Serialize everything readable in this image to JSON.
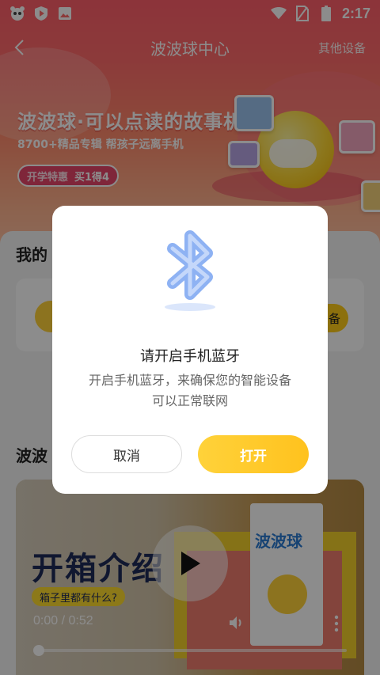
{
  "status_bar": {
    "time": "2:17",
    "left_icons": [
      "panda-icon",
      "play-shield-icon",
      "image-icon"
    ],
    "right_icons": [
      "wifi-icon",
      "no-sim-icon",
      "battery-icon"
    ]
  },
  "header": {
    "title": "波波球中心",
    "right_link": "其他设备",
    "back_icon": "chevron-left-icon"
  },
  "banner": {
    "title": "波波球·可以点读的故事机",
    "subtitle": "8700+精品专辑 帮孩子远离手机",
    "badge_left": "开学特惠",
    "badge_right": "买1得4"
  },
  "content": {
    "my_devices_title": "我的",
    "device_button_partial": "备",
    "video_section_title": "波波",
    "video": {
      "heading": "开箱介绍",
      "chip": "箱子里都有什么?",
      "time": "0:00 / 0:52",
      "package_title": "波波球"
    }
  },
  "dialog": {
    "title": "请开启手机蓝牙",
    "message_line1": "开启手机蓝牙，来确保您的智能设备",
    "message_line2": "可以正常联网",
    "cancel_label": "取消",
    "open_label": "打开",
    "illustration_icon": "bluetooth-icon"
  },
  "colors": {
    "accent_yellow": "#ffc21e",
    "banner_red": "#ff5f6b",
    "scrim": "rgba(0,0,0,0.45)"
  }
}
